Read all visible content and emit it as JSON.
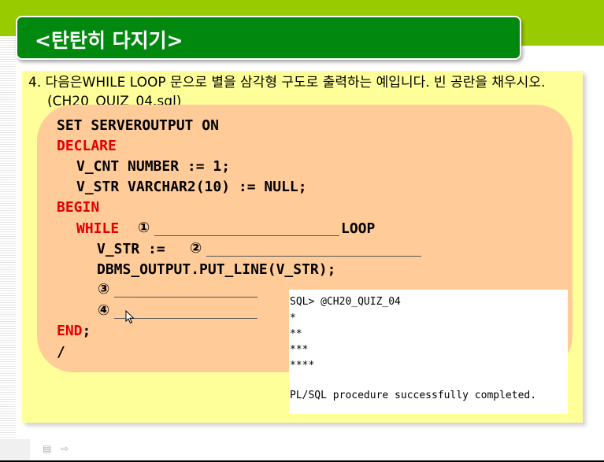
{
  "slide": {
    "title": "<탄탄히 다지기>",
    "question": "4. 다음은WHILE LOOP 문으로 별을 삼각형 구도로 출력하는 예입니다. 빈 공란을 채우시오.(CH20_QUIZ_04.sql)"
  },
  "code": {
    "line1": "SET SERVEROUTPUT ON",
    "declare": "DECLARE",
    "line3": "V_CNT NUMBER := 1;",
    "line4": "V_STR VARCHAR2(10) := NULL;",
    "begin": "BEGIN",
    "while": "WHILE",
    "blank1_marker": "①",
    "loop": "LOOP",
    "vstr_assign": "V_STR := ",
    "blank2_marker": "②",
    "put_line": "DBMS_OUTPUT.PUT_LINE(V_STR);",
    "blank3_marker": "③",
    "blank4_marker": "④",
    "end_kw": "END",
    "end_semicolon": ";",
    "slash": "/"
  },
  "console": {
    "lines": [
      "SQL> @CH20_QUIZ_04",
      "*",
      "**",
      "***",
      "****",
      "",
      "PL/SQL procedure successfully completed."
    ]
  },
  "colors": {
    "title_bar": "#00880f",
    "top_band": "#99cc00",
    "panel": "#ffff99",
    "code_box": "#ffcc99",
    "keyword": "#e00000"
  },
  "icons": [
    "mouse-pointer-icon",
    "slide-nav-menu-icon",
    "slide-nav-arrow-icon"
  ]
}
